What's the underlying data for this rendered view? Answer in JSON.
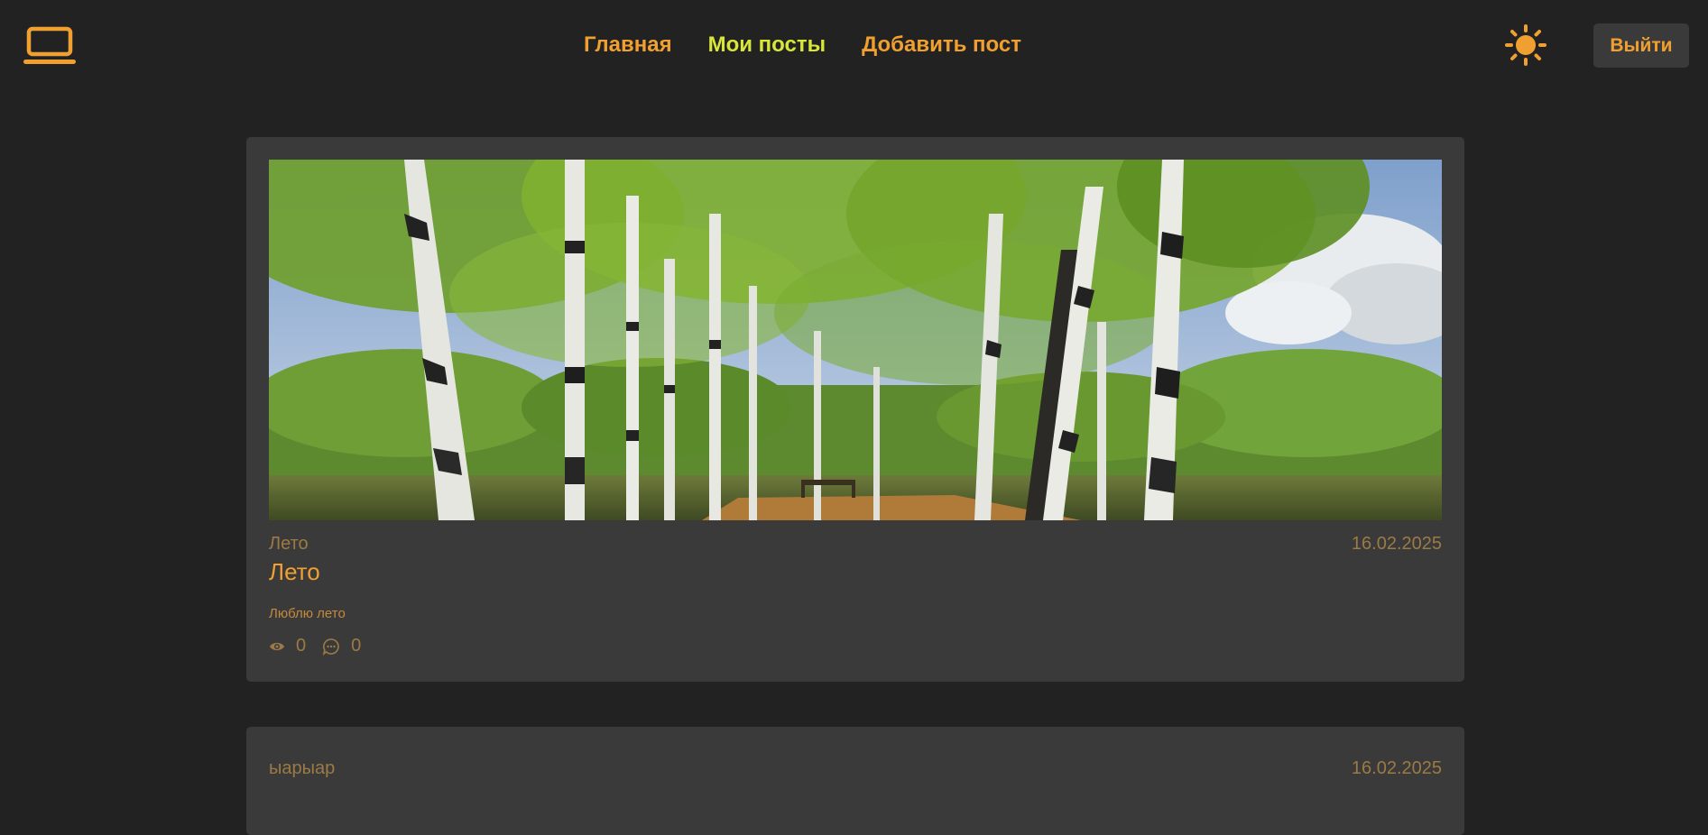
{
  "colors": {
    "background": "#222222",
    "card": "#3a3a3a",
    "accent": "#f0a030",
    "nav_active": "#d8e63a",
    "muted_text": "#9c7a45",
    "desc_text": "#c48a3a"
  },
  "header": {
    "logo_icon": "laptop-icon",
    "nav": {
      "home": "Главная",
      "my_posts": "Мои посты",
      "add_post": "Добавить пост"
    },
    "theme_icon": "sun-icon",
    "logout_label": "Выйти"
  },
  "posts": [
    {
      "image": "birch-grove-by-lake-photo",
      "category": "Лето",
      "date": "16.02.2025",
      "title": "Лето",
      "description": "Люблю лето",
      "views": "0",
      "comments": "0"
    },
    {
      "category": "ыарыар",
      "date": "16.02.2025"
    }
  ]
}
